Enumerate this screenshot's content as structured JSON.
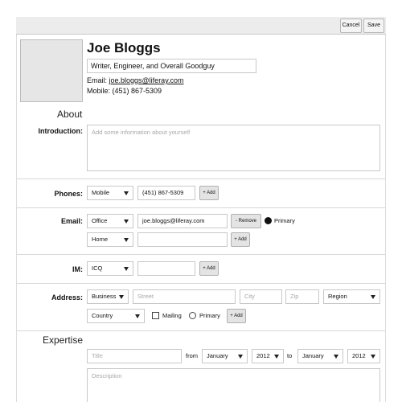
{
  "toolbar": {
    "cancel_label": "Cancel",
    "save_label": "Save"
  },
  "profile": {
    "name": "Joe Bloggs",
    "headline": "Writer, Engineer, and Overall Goodguy",
    "email_prefix": "Email: ",
    "email": "joe.bloggs@liferay.com",
    "mobile_line": "Mobile: (451) 867-5309"
  },
  "about": {
    "title": "About",
    "intro_label": "Introduction:",
    "intro_placeholder": "Add some information about yourself"
  },
  "phones": {
    "label": "Phones:",
    "type": "Mobile",
    "number": "(451) 867-5309",
    "add_label": "+ Add"
  },
  "emails": {
    "label": "Email:",
    "rows": [
      {
        "type": "Office",
        "value": "joe.bloggs@liferay.com",
        "remove_label": "- Remove",
        "primary_label": "Primary"
      },
      {
        "type": "Home",
        "value": "",
        "add_label": "+ Add"
      }
    ]
  },
  "im": {
    "label": "IM:",
    "type": "ICQ",
    "value": "",
    "add_label": "+ Add"
  },
  "address": {
    "label": "Address:",
    "type": "Business",
    "street_placeholder": "Street",
    "city_placeholder": "City",
    "zip_placeholder": "Zip",
    "region": "Region",
    "country": "Country",
    "mailing_label": "Mailing",
    "primary_label": "Primary",
    "add_label": "+ Add"
  },
  "expertise": {
    "title": "Expertise",
    "title_placeholder": "Title",
    "from_label": "from",
    "from_month": "January",
    "from_year": "2012",
    "to_label": "to",
    "to_month": "January",
    "to_year": "2012",
    "description_placeholder": "Description"
  }
}
